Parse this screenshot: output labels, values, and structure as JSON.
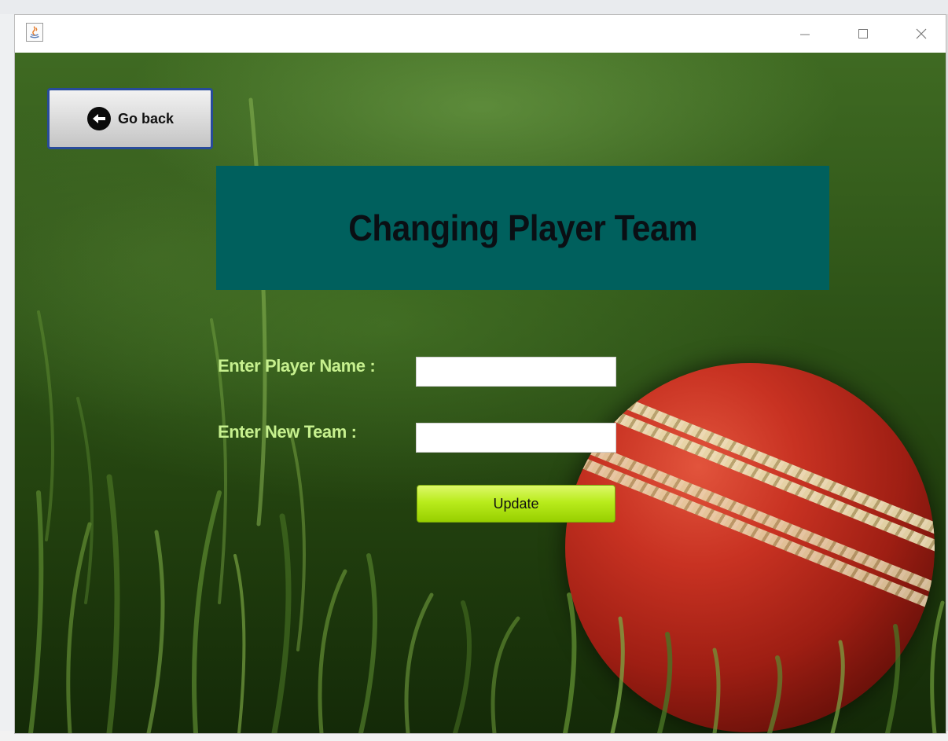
{
  "window": {
    "app_icon": "java-app-icon",
    "controls": {
      "minimize": "minimize-icon",
      "maximize": "maximize-icon",
      "close": "close-icon"
    }
  },
  "header": {
    "back_label": "Go back",
    "back_icon": "arrow-left-circle-icon",
    "title": "Changing Player Team"
  },
  "form": {
    "player_label": "Enter Player Name :",
    "player_value": "",
    "team_label": "Enter New Team :",
    "team_value": "",
    "update_label": "Update"
  },
  "colors": {
    "title_panel": "#00605d",
    "label_text": "#c6f08e",
    "update_button": "#b9ec1c",
    "back_button_border": "#284b9a"
  }
}
